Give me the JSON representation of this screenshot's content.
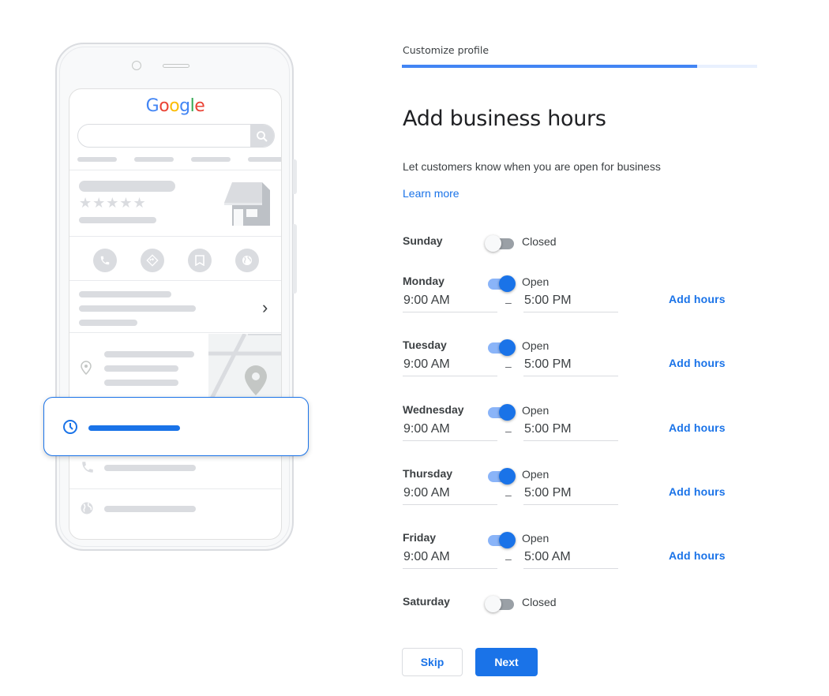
{
  "header": {
    "step_label": "Customize profile",
    "progress_percent": 83
  },
  "main": {
    "title": "Add business hours",
    "subtitle": "Let customers know when you are open for business",
    "learn_more": "Learn more"
  },
  "illustration": {
    "logo_letters": [
      {
        "char": "G",
        "color": "#4285f4"
      },
      {
        "char": "o",
        "color": "#ea4335"
      },
      {
        "char": "o",
        "color": "#fbbc05"
      },
      {
        "char": "g",
        "color": "#4285f4"
      },
      {
        "char": "l",
        "color": "#34a853"
      },
      {
        "char": "e",
        "color": "#ea4335"
      }
    ],
    "stars": "★★★★★",
    "chevron": "›"
  },
  "days": [
    {
      "name": "Sunday",
      "open": false,
      "status": "Closed"
    },
    {
      "name": "Monday",
      "open": true,
      "status": "Open",
      "open_time": "9:00 AM",
      "close_time": "5:00 PM",
      "add_hours": "Add hours"
    },
    {
      "name": "Tuesday",
      "open": true,
      "status": "Open",
      "open_time": "9:00 AM",
      "close_time": "5:00 PM",
      "add_hours": "Add hours"
    },
    {
      "name": "Wednesday",
      "open": true,
      "status": "Open",
      "open_time": "9:00 AM",
      "close_time": "5:00 PM",
      "add_hours": "Add hours"
    },
    {
      "name": "Thursday",
      "open": true,
      "status": "Open",
      "open_time": "9:00 AM",
      "close_time": "5:00 PM",
      "add_hours": "Add hours"
    },
    {
      "name": "Friday",
      "open": true,
      "status": "Open",
      "open_time": "9:00 AM",
      "close_time": "5:00 AM",
      "add_hours": "Add hours"
    },
    {
      "name": "Saturday",
      "open": false,
      "status": "Closed"
    }
  ],
  "time_separator": "–",
  "footer": {
    "skip_label": "Skip",
    "next_label": "Next"
  },
  "colors": {
    "accent": "#1a73e8",
    "progress": "#4285f4",
    "toggle_on_track": "#8ab4f8",
    "toggle_off_track": "#9aa0a6"
  }
}
